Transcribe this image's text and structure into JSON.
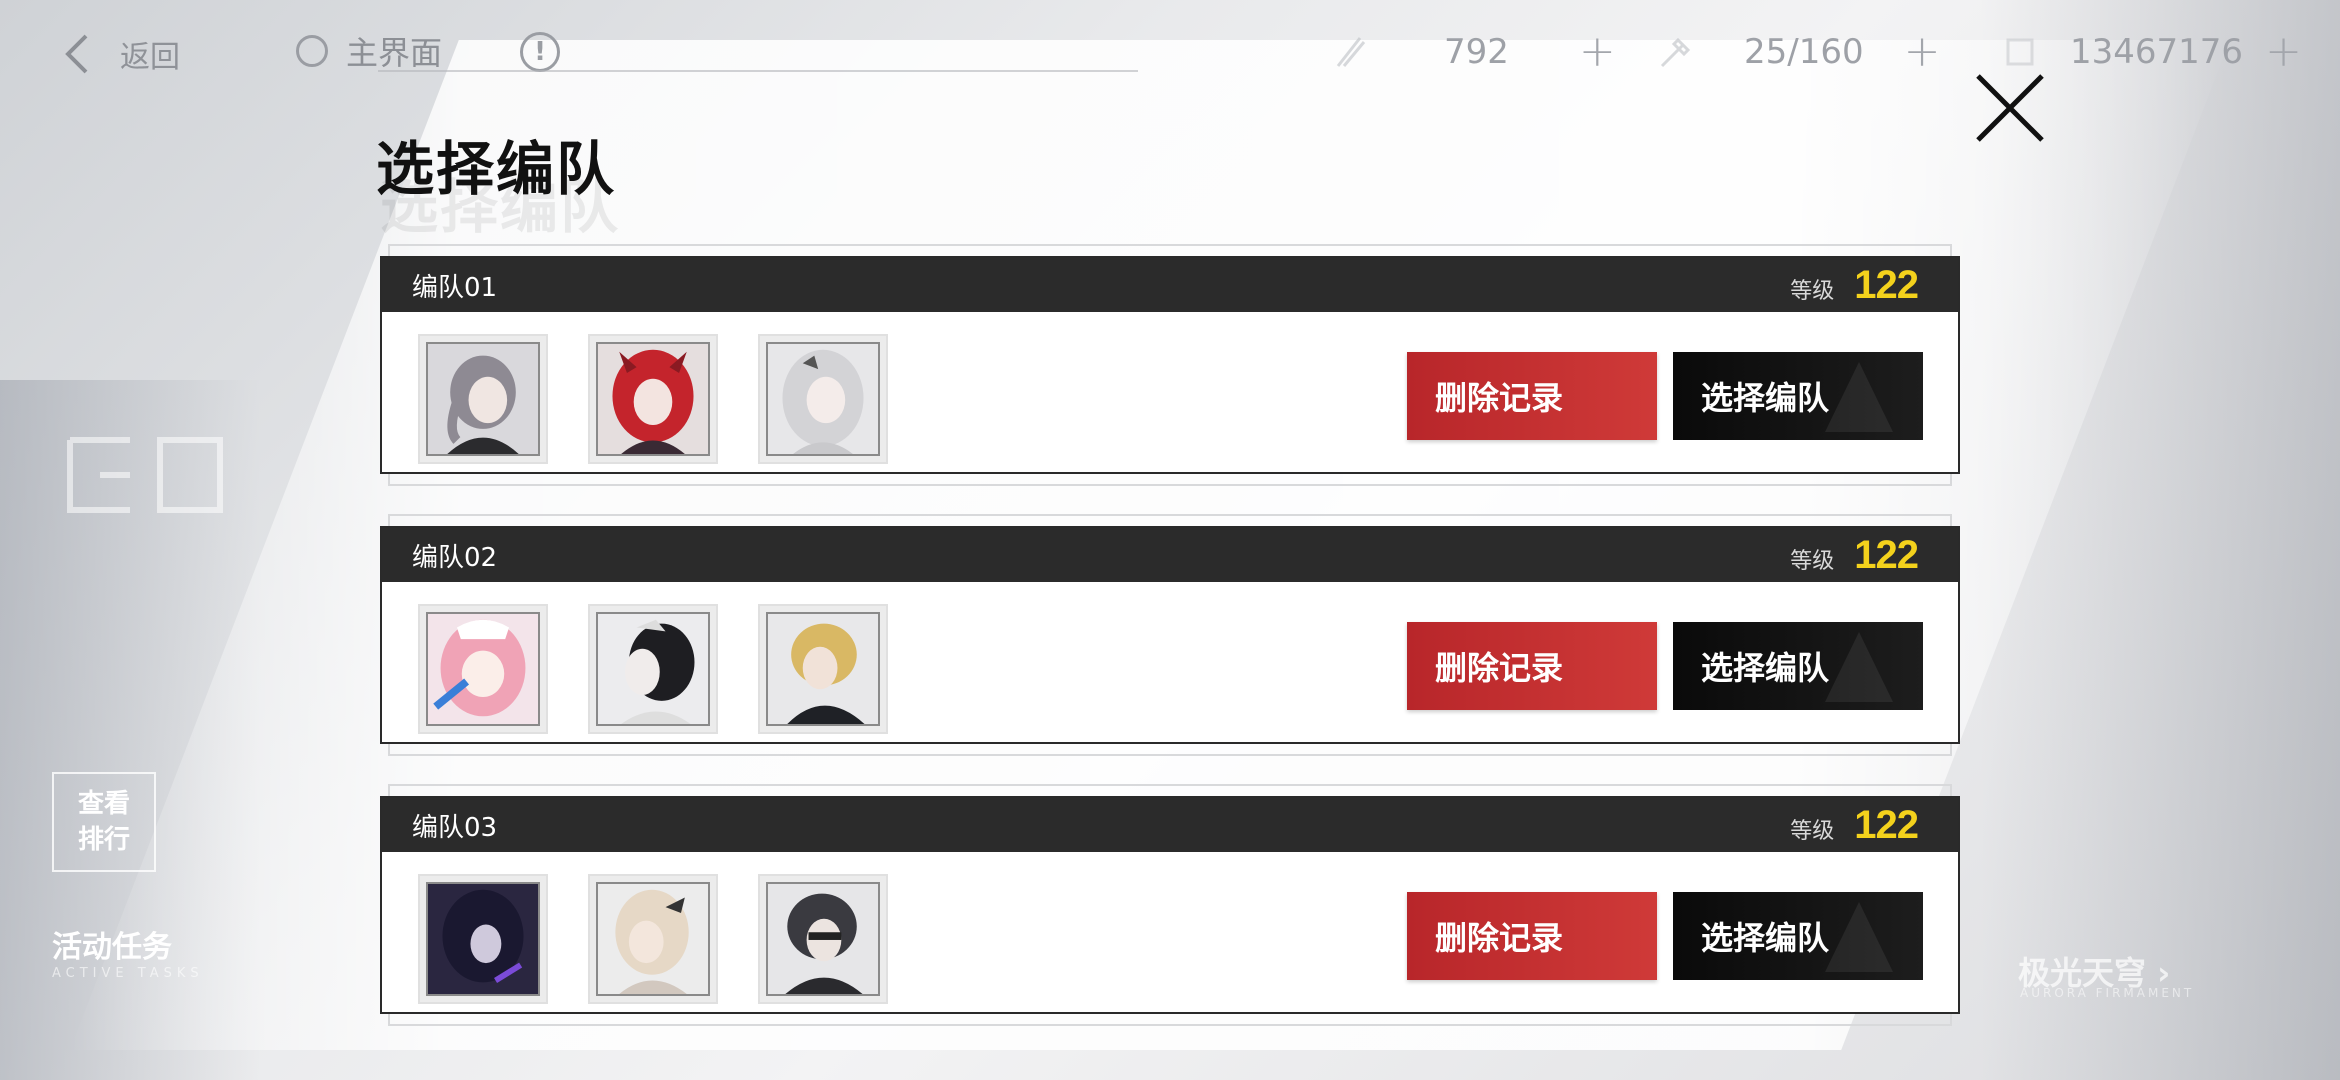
{
  "topbar": {
    "back_label": "返回",
    "home_label": "主界面",
    "resources": [
      {
        "icon": "stamina-icon",
        "value": "792"
      },
      {
        "icon": "key-icon",
        "value": "25/160"
      },
      {
        "icon": "coin-icon",
        "value": "13467176"
      }
    ]
  },
  "title": "选择编队",
  "teams": [
    {
      "name": "编队01",
      "level_label": "等级",
      "level": "122",
      "members": [
        "member-1",
        "member-2",
        "member-3"
      ],
      "delete_label": "删除记录",
      "select_label": "选择编队"
    },
    {
      "name": "编队02",
      "level_label": "等级",
      "level": "122",
      "members": [
        "member-1",
        "member-2",
        "member-3"
      ],
      "delete_label": "删除记录",
      "select_label": "选择编队"
    },
    {
      "name": "编队03",
      "level_label": "等级",
      "level": "122",
      "members": [
        "member-1",
        "member-2",
        "member-3"
      ],
      "delete_label": "删除记录",
      "select_label": "选择编队"
    }
  ],
  "side": {
    "ranking_line1": "查看",
    "ranking_line2": "排行",
    "activity_label": "活动任务",
    "activity_sub": "ACTIVE TASKS",
    "aurora_label": "极光天穹",
    "aurora_sub": "AURORA FIRMAMENT"
  },
  "colors": {
    "delete_button": "#c3302f",
    "select_button": "#111111",
    "level_value": "#f4d21c",
    "header_bar": "#2b2b2b"
  }
}
